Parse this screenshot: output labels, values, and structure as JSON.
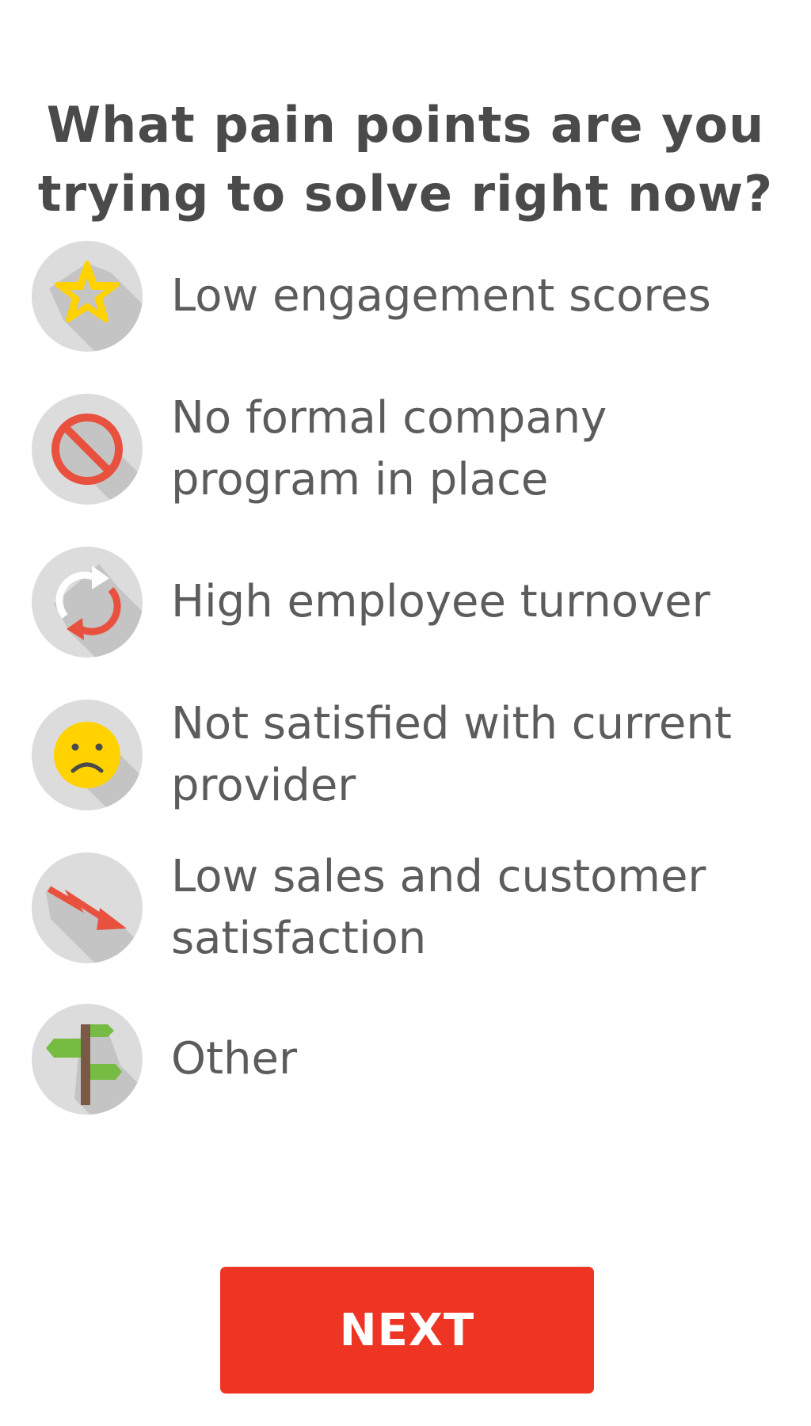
{
  "header": {
    "title_line1": "What pain points are you",
    "title_line2": "trying to solve right now?"
  },
  "options": [
    {
      "label": "Low engagement scores",
      "icon": "star-icon"
    },
    {
      "label": "No formal company program in place",
      "icon": "no-entry-icon"
    },
    {
      "label": "High employee turnover",
      "icon": "refresh-icon"
    },
    {
      "label": "Not satisfied with current provider",
      "icon": "sad-face-icon"
    },
    {
      "label": "Low sales and customer satisfaction",
      "icon": "trend-down-icon"
    },
    {
      "label": "Other",
      "icon": "signpost-icon"
    }
  ],
  "footer": {
    "next_label": "NEXT"
  },
  "colors": {
    "accent": "#ee3524",
    "icon_bg": "#dcdcdc",
    "icon_shadow": "#c2c2c2",
    "star": "#ffd200",
    "icon_red": "#e8513e",
    "sign_green": "#76bc43",
    "post_brown": "#7a5a44",
    "text": "#5c5c5c"
  }
}
